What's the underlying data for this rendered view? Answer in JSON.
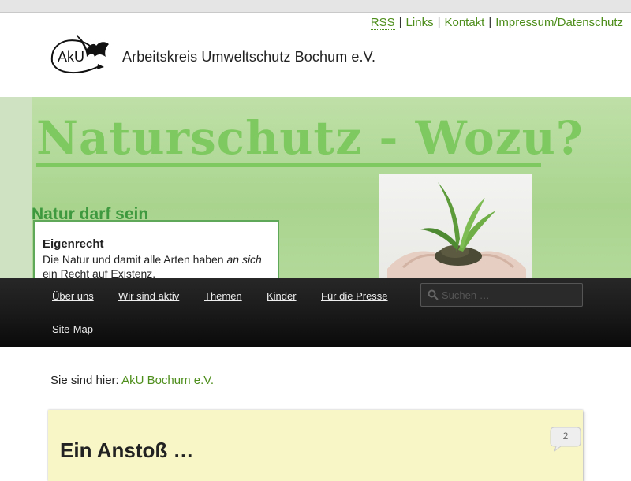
{
  "header": {
    "links": [
      {
        "label": "RSS"
      },
      {
        "label": "Links"
      },
      {
        "label": "Kontakt"
      },
      {
        "label": "Impressum/Datenschutz"
      }
    ],
    "separator": "|",
    "logo": {
      "mark": "AkU",
      "org_name": "Arbeitskreis Umweltschutz Bochum e.V."
    }
  },
  "banner": {
    "headline": "Naturschutz - Wozu?",
    "subhead": "Natur darf sein",
    "card": {
      "title": "Eigenrecht",
      "text_before": "Die Natur und damit alle Arten haben",
      "text_italic": "an sich",
      "text_after": "ein Recht auf Existenz."
    }
  },
  "nav": {
    "items": [
      {
        "label": "Über uns"
      },
      {
        "label": "Wir sind aktiv"
      },
      {
        "label": "Themen"
      },
      {
        "label": "Kinder"
      },
      {
        "label": "Für die Presse"
      },
      {
        "label": "Site-Map"
      }
    ],
    "search": {
      "placeholder": "Suchen …",
      "icon": "search-icon"
    }
  },
  "breadcrumb": {
    "prefix": "Sie sind hier:",
    "link": "AkU Bochum e.V."
  },
  "post": {
    "title": "Ein Anstoß …",
    "comment_count": "2"
  },
  "colors": {
    "link": "#4e8e1c",
    "nav_bg": "#1a1a1a",
    "post_bg": "#f8f6c6",
    "banner_green": "#7ec960"
  }
}
